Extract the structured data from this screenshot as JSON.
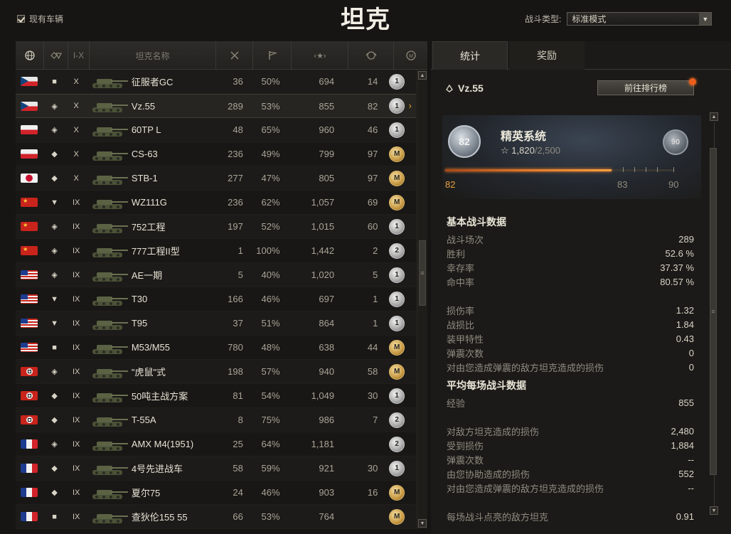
{
  "header": {
    "owned_label": "现有车辆",
    "title": "坦克",
    "battle_type_label": "战斗类型:",
    "battle_type_value": "标准模式"
  },
  "table": {
    "columns": [
      "",
      "",
      "I-X",
      "坦克名称",
      "",
      "",
      "",
      "",
      ""
    ],
    "rows": [
      {
        "flag": "czech",
        "cls": "■",
        "tier": "X",
        "name": "征服者GC",
        "battles": "36",
        "win": "50%",
        "xp": "694",
        "mastery": "14",
        "badge": "1",
        "badge_type": "silver"
      },
      {
        "flag": "czech",
        "cls": "◈",
        "tier": "X",
        "name": "Vz.55",
        "battles": "289",
        "win": "53%",
        "xp": "855",
        "mastery": "82",
        "badge": "1",
        "badge_type": "silver",
        "selected": true
      },
      {
        "flag": "poland",
        "cls": "◈",
        "tier": "X",
        "name": "60TP L",
        "battles": "48",
        "win": "65%",
        "xp": "960",
        "mastery": "46",
        "badge": "1",
        "badge_type": "silver"
      },
      {
        "flag": "poland",
        "cls": "◆",
        "tier": "X",
        "name": "CS-63",
        "battles": "236",
        "win": "49%",
        "xp": "799",
        "mastery": "97",
        "badge": "M",
        "badge_type": "gold"
      },
      {
        "flag": "japan",
        "cls": "◆",
        "tier": "X",
        "name": "STB-1",
        "battles": "277",
        "win": "47%",
        "xp": "805",
        "mastery": "97",
        "badge": "M",
        "badge_type": "gold"
      },
      {
        "flag": "china",
        "cls": "▼",
        "tier": "IX",
        "name": "WZ111G",
        "battles": "236",
        "win": "62%",
        "xp": "1,057",
        "mastery": "69",
        "badge": "M",
        "badge_type": "gold"
      },
      {
        "flag": "ussr",
        "cls": "◈",
        "tier": "IX",
        "name": "752工程",
        "battles": "197",
        "win": "52%",
        "xp": "1,015",
        "mastery": "60",
        "badge": "1",
        "badge_type": "silver"
      },
      {
        "flag": "ussr",
        "cls": "◈",
        "tier": "IX",
        "name": "777工程II型",
        "battles": "1",
        "win": "100%",
        "xp": "1,442",
        "mastery": "2",
        "badge": "2",
        "badge_type": "silver"
      },
      {
        "flag": "usa",
        "cls": "◈",
        "tier": "IX",
        "name": "AE一期",
        "battles": "5",
        "win": "40%",
        "xp": "1,020",
        "mastery": "5",
        "badge": "1",
        "badge_type": "silver"
      },
      {
        "flag": "usa",
        "cls": "▼",
        "tier": "IX",
        "name": "T30",
        "battles": "166",
        "win": "46%",
        "xp": "697",
        "mastery": "1",
        "badge": "1",
        "badge_type": "silver"
      },
      {
        "flag": "usa",
        "cls": "▼",
        "tier": "IX",
        "name": "T95",
        "battles": "37",
        "win": "51%",
        "xp": "864",
        "mastery": "1",
        "badge": "1",
        "badge_type": "silver"
      },
      {
        "flag": "usa",
        "cls": "■",
        "tier": "IX",
        "name": "M53/M55",
        "battles": "780",
        "win": "48%",
        "xp": "638",
        "mastery": "44",
        "badge": "M",
        "badge_type": "gold"
      },
      {
        "flag": "germany",
        "cls": "◈",
        "tier": "IX",
        "name": "\"虎鼠\"式",
        "battles": "198",
        "win": "57%",
        "xp": "940",
        "mastery": "58",
        "badge": "M",
        "badge_type": "gold"
      },
      {
        "flag": "germany",
        "cls": "◆",
        "tier": "IX",
        "name": "50吨主战方案",
        "battles": "81",
        "win": "54%",
        "xp": "1,049",
        "mastery": "30",
        "badge": "1",
        "badge_type": "silver"
      },
      {
        "flag": "germany",
        "cls": "◆",
        "tier": "IX",
        "name": "T-55A",
        "battles": "8",
        "win": "75%",
        "xp": "986",
        "mastery": "7",
        "badge": "2",
        "badge_type": "silver"
      },
      {
        "flag": "france",
        "cls": "◈",
        "tier": "IX",
        "name": "AMX M4(1951)",
        "battles": "25",
        "win": "64%",
        "xp": "1,181",
        "mastery": "",
        "badge": "2",
        "badge_type": "silver"
      },
      {
        "flag": "france",
        "cls": "◆",
        "tier": "IX",
        "name": "4号先进战车",
        "battles": "58",
        "win": "59%",
        "xp": "921",
        "mastery": "30",
        "badge": "1",
        "badge_type": "silver"
      },
      {
        "flag": "france",
        "cls": "◆",
        "tier": "IX",
        "name": "夏尔75",
        "battles": "24",
        "win": "46%",
        "xp": "903",
        "mastery": "16",
        "badge": "M",
        "badge_type": "gold"
      },
      {
        "flag": "france",
        "cls": "■",
        "tier": "IX",
        "name": "查狄伦155 55",
        "battles": "66",
        "win": "53%",
        "xp": "764",
        "mastery": "",
        "badge": "M",
        "badge_type": "gold"
      }
    ]
  },
  "panel": {
    "tabs": [
      "统计",
      "奖励"
    ],
    "vehicle": "Vz.55",
    "ranking_button": "前往排行榜",
    "elite": {
      "title": "精英系统",
      "current_level": "82",
      "next_emblem": "90",
      "points": "1,820",
      "points_max": "/2,500",
      "progress": 0.728,
      "level_current": "82",
      "level_next": "83",
      "level_max": "90"
    },
    "basic_title": "基本战斗数据",
    "basic": [
      {
        "k": "战斗场次",
        "v": "289"
      },
      {
        "k": "胜利",
        "v": "52.6 %"
      },
      {
        "k": "幸存率",
        "v": "37.37 %"
      },
      {
        "k": "命中率",
        "v": "80.57 %"
      }
    ],
    "basic2": [
      {
        "k": "损伤率",
        "v": "1.32"
      },
      {
        "k": "战损比",
        "v": "1.84"
      },
      {
        "k": "装甲特性",
        "v": "0.43"
      },
      {
        "k": "弹震次数",
        "v": "0"
      },
      {
        "k": "对由您造成弹震的敌方坦克造成的损伤",
        "v": "0"
      }
    ],
    "avg_title": "平均每场战斗数据",
    "avg": [
      {
        "k": "经验",
        "v": "855"
      }
    ],
    "avg2": [
      {
        "k": "对敌方坦克造成的损伤",
        "v": "2,480"
      },
      {
        "k": "受到损伤",
        "v": "1,884"
      },
      {
        "k": "弹震次数",
        "v": "--"
      },
      {
        "k": "由您协助造成的损伤",
        "v": "552"
      },
      {
        "k": "对由您造成弹震的敌方坦克造成的损伤",
        "v": "--"
      }
    ],
    "avg3": [
      {
        "k": "每场战斗点亮的敌方坦克",
        "v": "0.91"
      }
    ]
  }
}
